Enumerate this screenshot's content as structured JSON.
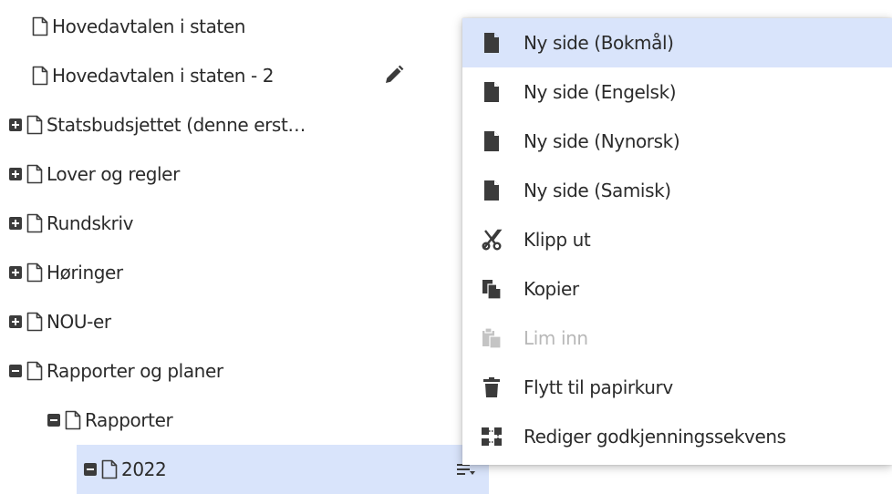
{
  "tree": {
    "items": [
      {
        "label": "Hovedavtalen i staten"
      },
      {
        "label": "Hovedavtalen i staten - 2"
      },
      {
        "label": "Statsbudsjettet (denne erst…"
      },
      {
        "label": "Lover og regler"
      },
      {
        "label": "Rundskriv"
      },
      {
        "label": "Høringer"
      },
      {
        "label": "NOU-er"
      },
      {
        "label": "Rapporter og planer"
      },
      {
        "label": "Rapporter"
      },
      {
        "label": "2022"
      }
    ]
  },
  "context_menu": {
    "items": [
      {
        "label": "Ny side (Bokmål)",
        "icon": "page-icon",
        "state": "highlighted"
      },
      {
        "label": "Ny side (Engelsk)",
        "icon": "page-icon"
      },
      {
        "label": "Ny side (Nynorsk)",
        "icon": "page-icon"
      },
      {
        "label": "Ny side (Samisk)",
        "icon": "page-icon"
      },
      {
        "label": "Klipp ut",
        "icon": "scissors-icon"
      },
      {
        "label": "Kopier",
        "icon": "copy-icon"
      },
      {
        "label": "Lim inn",
        "icon": "paste-icon",
        "state": "disabled"
      },
      {
        "label": "Flytt til papirkurv",
        "icon": "trash-icon"
      },
      {
        "label": "Rediger godkjenningssekvens",
        "icon": "workflow-icon"
      }
    ]
  },
  "colors": {
    "highlight": "#d9e4fb",
    "icon": "#3b3b3b",
    "disabled": "#b8b8b8"
  }
}
